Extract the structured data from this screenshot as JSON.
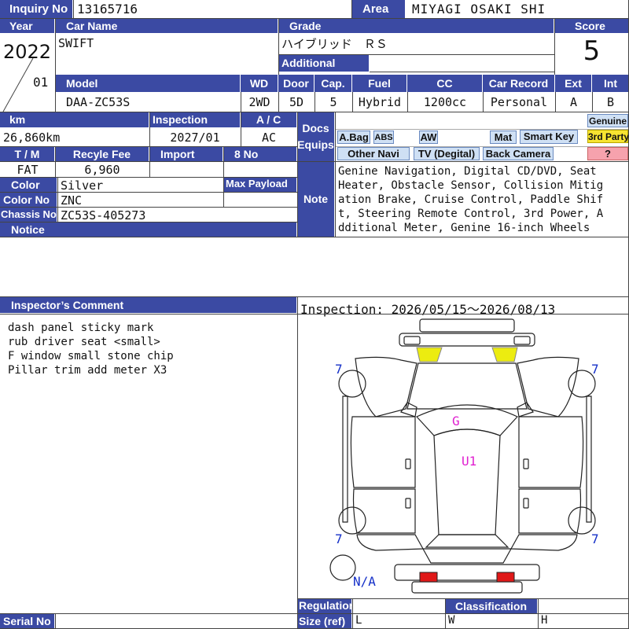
{
  "labels": {
    "inquiry_no": "Inquiry No",
    "area": "Area",
    "year": "Year",
    "car_name": "Car Name",
    "grade": "Grade",
    "score": "Score",
    "additional_grade": "Additional Grade",
    "model": "Model",
    "wd": "WD",
    "door": "Door",
    "cap": "Cap.",
    "fuel": "Fuel",
    "cc": "CC",
    "car_record": "Car Record",
    "ext": "Ext",
    "int": "Int",
    "km": "km",
    "inspection": "Inspection",
    "ac": "A / C",
    "docs_equips": "Docs Equips",
    "tm": "T / M",
    "recycle_fee": "Recyle Fee",
    "import": "Import",
    "eight_no": "8 No",
    "color": "Color",
    "max_payload": "Max Payload",
    "color_no": "Color No",
    "note": "Note",
    "chassis_no": "Chassis No",
    "notice": "Notice",
    "inspectors_comment": "Inspector’s Comment",
    "regulation": "Regulation",
    "classification": "Classification",
    "serial_no": "Serial No",
    "size_ref": "Size (ref)",
    "size_l": "L",
    "size_w": "W",
    "size_h": "H"
  },
  "values": {
    "inquiry_no": "13165716",
    "area": "MIYAGI OSAKI SHI",
    "year": "2022",
    "month": "01",
    "car_name": "SWIFT",
    "grade": "ハイブリッド　ＲＳ",
    "score": "5",
    "model": "DAA-ZC53S",
    "wd": "2WD",
    "door": "5D",
    "cap": "5",
    "fuel": "Hybrid",
    "cc": "1200cc",
    "car_record": "Personal",
    "ext": "A",
    "int": "B",
    "km": "26,860km",
    "inspection": "2027/01",
    "ac": "AC",
    "tm": "FAT",
    "recycle_fee": "6,960",
    "color": "Silver",
    "color_no": "ZNC",
    "chassis_no": "ZC53S-405273"
  },
  "equips": {
    "abag": "A.Bag",
    "abs": "ABS",
    "aw": "AW",
    "mat": "Mat",
    "smart_key": "Smart Key",
    "genuine": "Genuine",
    "third_party": "3rd Party",
    "other_navi": "Other Navi",
    "tv": "TV (Degital)",
    "back_camera": "Back Camera",
    "question": "?"
  },
  "note_lines": [
    "Genine Navigation, Digital CD/DVD, Seat",
    "Heater, Obstacle Sensor, Collision Mitig",
    "ation Brake, Cruise Control, Paddle Shif",
    "t, Steering Remote Control, 3rd Power, A",
    "dditional Meter, Genine 16-inch Wheels"
  ],
  "comment_lines": [
    "dash panel sticky mark",
    "rub driver seat <small>",
    "F window small stone chip",
    "Pillar trim add meter X3"
  ],
  "diagram": {
    "period": "Inspection: 2026/05/15〜2026/08/13",
    "tire_fl": "7",
    "tire_fr": "7",
    "tire_rl": "7",
    "tire_rr": "7",
    "mark_g": "G",
    "mark_u1": "U1",
    "spare": "N/A",
    "tire_color": "#1530c8",
    "mark_color": "#e020d0"
  }
}
